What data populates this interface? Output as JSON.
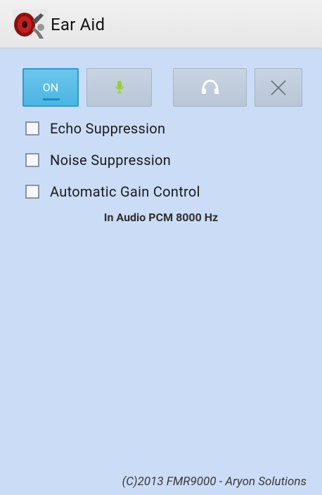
{
  "app": {
    "title": "Ear Aid",
    "icon": "ear-horn-icon"
  },
  "controls": {
    "on_label": "ON",
    "mic_icon": "microphone-icon",
    "headset_icon": "headset-icon",
    "close_icon": "close-icon"
  },
  "options": [
    {
      "label": "Echo Suppression",
      "checked": false
    },
    {
      "label": "Noise Suppression",
      "checked": false
    },
    {
      "label": "Automatic Gain Control",
      "checked": false
    }
  ],
  "status": "In Audio PCM 8000 Hz",
  "footer": "(C)2013 FMR9000 - Aryon Solutions",
  "colors": {
    "background": "#cbdcf6",
    "on_button": "#4bb5e2",
    "mic_accent": "#9acd32"
  }
}
